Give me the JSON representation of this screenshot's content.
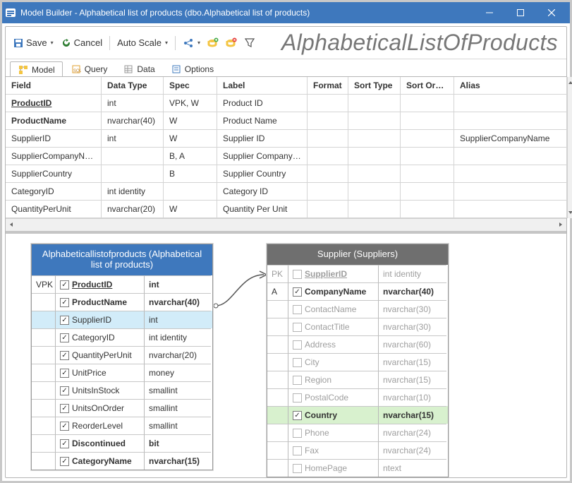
{
  "window": {
    "title": "Model Builder - Alphabetical list of products (dbo.Alphabetical list of products)"
  },
  "toolbar": {
    "save": "Save",
    "cancel": "Cancel",
    "autoscale": "Auto Scale",
    "headline": "AlphabeticalListOfProducts"
  },
  "tabs": [
    "Model",
    "Query",
    "Data",
    "Options"
  ],
  "grid": {
    "headers": [
      "Field",
      "Data Type",
      "Spec",
      "Label",
      "Format",
      "Sort Type",
      "Sort Order",
      "Alias"
    ],
    "rows": [
      {
        "field": "ProductID",
        "pk": true,
        "bold": true,
        "type": "int",
        "spec": "VPK, W",
        "label": "Product ID",
        "format": "",
        "sorttype": "",
        "sortorder": "",
        "alias": ""
      },
      {
        "field": "ProductName",
        "bold": true,
        "type": "nvarchar(40)",
        "spec": "W",
        "label": "Product Name",
        "format": "",
        "sorttype": "",
        "sortorder": "",
        "alias": ""
      },
      {
        "field": "SupplierID",
        "type": "int",
        "spec": "W",
        "label": "Supplier ID",
        "format": "",
        "sorttype": "",
        "sortorder": "",
        "alias": "SupplierCompanyName"
      },
      {
        "field": "SupplierCompanyName",
        "type": "",
        "spec": "B, A",
        "label": "Supplier Company Name",
        "format": "",
        "sorttype": "",
        "sortorder": "",
        "alias": ""
      },
      {
        "field": "SupplierCountry",
        "type": "",
        "spec": "B",
        "label": "Supplier Country",
        "format": "",
        "sorttype": "",
        "sortorder": "",
        "alias": ""
      },
      {
        "field": "CategoryID",
        "type": "int identity",
        "spec": "",
        "label": "Category ID",
        "format": "",
        "sorttype": "",
        "sortorder": "",
        "alias": ""
      },
      {
        "field": "QuantityPerUnit",
        "type": "nvarchar(20)",
        "spec": "W",
        "label": "Quantity Per Unit",
        "format": "",
        "sorttype": "",
        "sortorder": "",
        "alias": ""
      }
    ]
  },
  "diagram": {
    "t1": {
      "title": "Alphabeticallistofproducts (Alphabetical list of products)",
      "rows": [
        {
          "key": "VPK",
          "chk": true,
          "name": "ProductID",
          "type": "int",
          "bold": true,
          "u": true
        },
        {
          "key": "",
          "chk": true,
          "name": "ProductName",
          "type": "nvarchar(40)",
          "bold": true
        },
        {
          "key": "",
          "chk": true,
          "name": "SupplierID",
          "type": "int",
          "sel": true
        },
        {
          "key": "",
          "chk": true,
          "name": "CategoryID",
          "type": "int identity"
        },
        {
          "key": "",
          "chk": true,
          "name": "QuantityPerUnit",
          "type": "nvarchar(20)"
        },
        {
          "key": "",
          "chk": true,
          "name": "UnitPrice",
          "type": "money"
        },
        {
          "key": "",
          "chk": true,
          "name": "UnitsInStock",
          "type": "smallint"
        },
        {
          "key": "",
          "chk": true,
          "name": "UnitsOnOrder",
          "type": "smallint"
        },
        {
          "key": "",
          "chk": true,
          "name": "ReorderLevel",
          "type": "smallint"
        },
        {
          "key": "",
          "chk": true,
          "name": "Discontinued",
          "type": "bit",
          "bold": true
        },
        {
          "key": "",
          "chk": true,
          "name": "CategoryName",
          "type": "nvarchar(15)",
          "bold": true
        }
      ]
    },
    "t2": {
      "title": "Supplier (Suppliers)",
      "rows": [
        {
          "key": "PK",
          "chk": false,
          "dim": true,
          "name": "SupplierID",
          "type": "int identity",
          "u": true
        },
        {
          "key": "A",
          "chk": true,
          "name": "CompanyName",
          "type": "nvarchar(40)",
          "bold": true
        },
        {
          "key": "",
          "chk": false,
          "dim": true,
          "name": "ContactName",
          "type": "nvarchar(30)"
        },
        {
          "key": "",
          "chk": false,
          "dim": true,
          "name": "ContactTitle",
          "type": "nvarchar(30)"
        },
        {
          "key": "",
          "chk": false,
          "dim": true,
          "name": "Address",
          "type": "nvarchar(60)"
        },
        {
          "key": "",
          "chk": false,
          "dim": true,
          "name": "City",
          "type": "nvarchar(15)"
        },
        {
          "key": "",
          "chk": false,
          "dim": true,
          "name": "Region",
          "type": "nvarchar(15)"
        },
        {
          "key": "",
          "chk": false,
          "dim": true,
          "name": "PostalCode",
          "type": "nvarchar(10)"
        },
        {
          "key": "",
          "chk": true,
          "name": "Country",
          "type": "nvarchar(15)",
          "grn": true,
          "bold": true
        },
        {
          "key": "",
          "chk": false,
          "dim": true,
          "name": "Phone",
          "type": "nvarchar(24)"
        },
        {
          "key": "",
          "chk": false,
          "dim": true,
          "name": "Fax",
          "type": "nvarchar(24)"
        },
        {
          "key": "",
          "chk": false,
          "dim": true,
          "name": "HomePage",
          "type": "ntext"
        }
      ]
    }
  }
}
